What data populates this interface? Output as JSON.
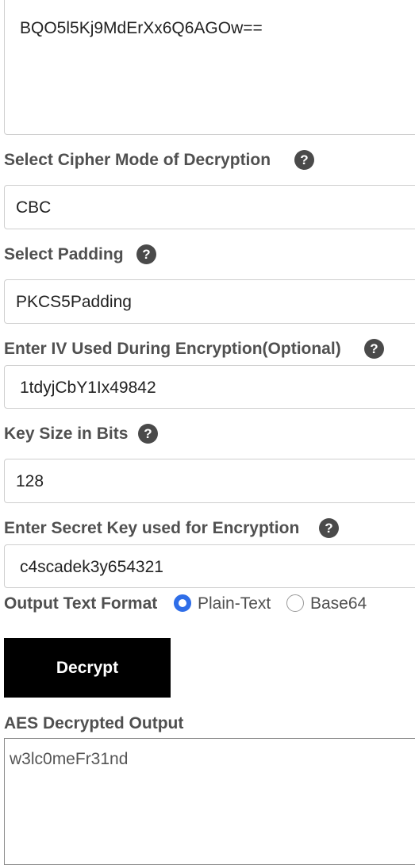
{
  "ciphertext": {
    "value": "BQO5l5Kj9MdErXx6Q6AGOw=="
  },
  "cipher_mode": {
    "label": "Select Cipher Mode of Decryption",
    "value": "CBC"
  },
  "padding": {
    "label": "Select Padding",
    "value": "PKCS5Padding"
  },
  "iv": {
    "label": "Enter IV Used During Encryption(Optional)",
    "value": "1tdyjCbY1Ix49842"
  },
  "key_size": {
    "label": "Key Size in Bits",
    "value": "128"
  },
  "secret_key": {
    "label": "Enter Secret Key used for Encryption",
    "value": "c4scadek3y654321"
  },
  "output_format": {
    "label": "Output Text Format",
    "options": [
      "Plain-Text",
      "Base64"
    ],
    "selected": "Plain-Text"
  },
  "decrypt_button": {
    "label": "Decrypt"
  },
  "output": {
    "label": "AES Decrypted Output",
    "value": "w3lc0meFr31nd"
  },
  "help_icon_glyph": "?",
  "colors": {
    "radio_selected": "#2f6ee8",
    "button_bg": "#000000"
  }
}
